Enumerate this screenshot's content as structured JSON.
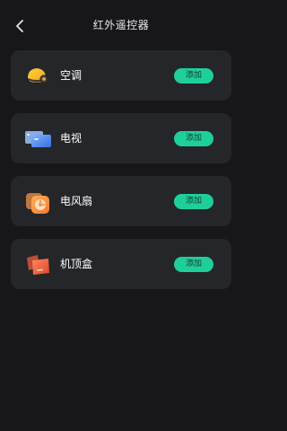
{
  "header": {
    "title": "红外遥控器"
  },
  "devices": [
    {
      "name": "空调",
      "icon": "air-conditioner-icon",
      "action": "添加"
    },
    {
      "name": "电视",
      "icon": "tv-icon",
      "action": "添加"
    },
    {
      "name": "电风扇",
      "icon": "fan-icon",
      "action": "添加"
    },
    {
      "name": "机顶盒",
      "icon": "set-top-box-icon",
      "action": "添加"
    }
  ],
  "colors": {
    "background": "#17171a",
    "card": "#25262a",
    "accent": "#1fcf9a"
  }
}
